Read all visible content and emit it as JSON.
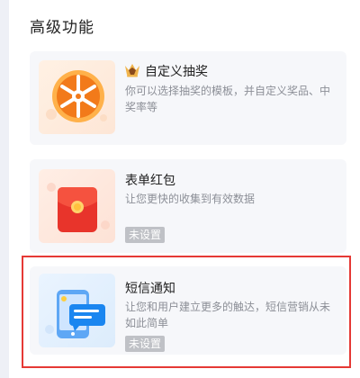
{
  "section": {
    "title": "高级功能"
  },
  "cards": [
    {
      "title": "自定义抽奖",
      "desc": "你可以选择抽奖的模板，并自定义奖品、中奖率等",
      "icon": "lottery-wheel-icon",
      "title_icon": "crown-icon"
    },
    {
      "title": "表单红包",
      "desc": "让您更快的收集到有效数据",
      "status": "未设置",
      "icon": "red-envelope-icon"
    },
    {
      "title": "短信通知",
      "desc": "让您和用户建立更多的触达，短信营销从未如此简单",
      "status": "未设置",
      "icon": "sms-phone-icon"
    }
  ],
  "colors": {
    "highlight": "#e53935",
    "card_bg": "#f6f7fa",
    "badge_bg": "#bfc1c6"
  }
}
